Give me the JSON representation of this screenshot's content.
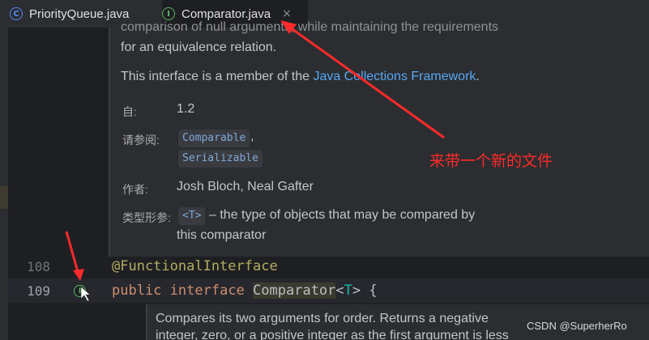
{
  "tabs": [
    {
      "label": "PriorityQueue.java",
      "icon": "class-icon"
    },
    {
      "label": "Comparator.java",
      "icon": "interface-icon",
      "close": "×"
    }
  ],
  "doc": {
    "partial_line": "comparison of null arguments, while maintaining the requirements",
    "line1": "for an equivalence relation.",
    "member_prefix": "This interface is a member of the ",
    "member_link": "Java Collections Framework",
    "member_suffix": ".",
    "since_label": "自:",
    "since_value": "1.2",
    "see_label": "请参阅:",
    "see_items": [
      "Comparable",
      "Serializable"
    ],
    "see_comma": ",",
    "author_label": "作者:",
    "author_value": "Josh Bloch, Neal Gafter",
    "typeparam_label": "类型形参:",
    "typeparam_name": "<T>",
    "typeparam_desc1": "– the type of objects that may be compared by",
    "typeparam_desc2": "this comparator"
  },
  "code": {
    "line108_no": "108",
    "line108": "@FunctionalInterface",
    "line109_no": "109",
    "line109_kw1": "public",
    "line109_kw2": "interface",
    "line109_name": "Comparator",
    "line109_lt": "<",
    "line109_T": "T",
    "line109_gt": ">",
    "line109_brace": " {"
  },
  "doc2": {
    "line1": "Compares its two arguments for order. Returns a negative",
    "line2": "integer, zero, or a positive integer as the first argument is less"
  },
  "annotation_text": "来带一个新的文件",
  "watermark": "CSDN @SuperherRo",
  "colors": {
    "accent": "#3574f0",
    "arrow": "#ff2a2a",
    "keyword": "#cf8e6d",
    "annotation": "#b3ae60"
  }
}
